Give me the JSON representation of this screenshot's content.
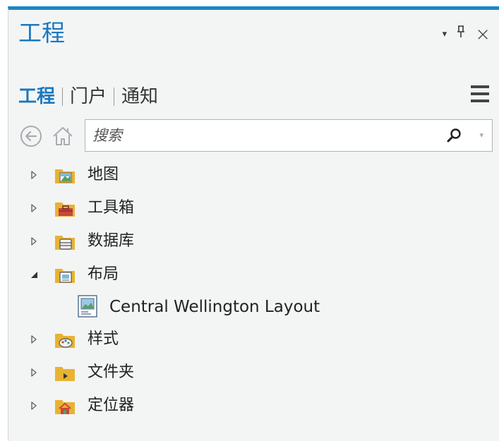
{
  "pane": {
    "title": "工程",
    "controls": {
      "menu_icon": "▾",
      "pin_icon": "ꟼ",
      "close_icon": "×"
    }
  },
  "tabs": [
    {
      "label": "工程",
      "active": true
    },
    {
      "label": "门户",
      "active": false
    },
    {
      "label": "通知",
      "active": false
    }
  ],
  "search": {
    "placeholder": "搜索",
    "value": ""
  },
  "tree": {
    "maps": {
      "label": "地图",
      "expanded": false
    },
    "toolboxes": {
      "label": "工具箱",
      "expanded": false
    },
    "databases": {
      "label": "数据库",
      "expanded": false
    },
    "layouts": {
      "label": "布局",
      "expanded": true,
      "children": [
        {
          "label": "Central Wellington Layout"
        }
      ]
    },
    "styles": {
      "label": "样式",
      "expanded": false
    },
    "folders": {
      "label": "文件夹",
      "expanded": false
    },
    "locators": {
      "label": "定位器",
      "expanded": false
    }
  },
  "colors": {
    "accent": "#1b78c0",
    "topbar": "#1c86c8",
    "panel_bg": "#f3f5f5",
    "folder": "#e8b332"
  }
}
